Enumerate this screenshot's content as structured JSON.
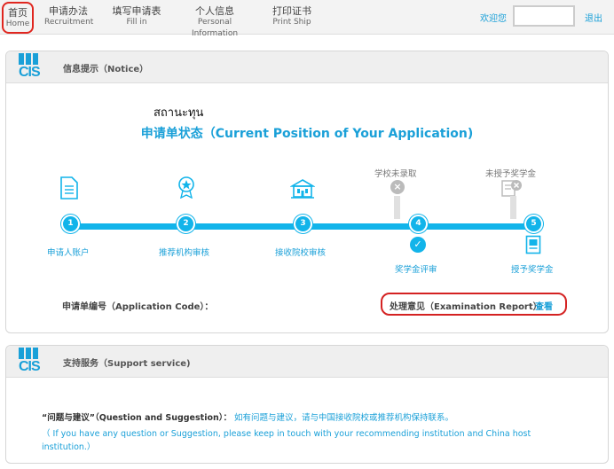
{
  "nav": {
    "home": {
      "cn": "首页",
      "en": "Home"
    },
    "recruitment": {
      "cn": "申请办法",
      "en": "Recruitment"
    },
    "fillin": {
      "cn": "填写申请表",
      "en": "Fill in"
    },
    "personal": {
      "cn": "个人信息",
      "en": "Personal Information"
    },
    "print": {
      "cn": "打印证书",
      "en": "Print Ship"
    },
    "welcome": "欢迎您",
    "logout": "退出"
  },
  "notice_panel": {
    "logo_text": "CIS",
    "title": "信息提示（Notice）",
    "overlay_text": "สถานะทุน",
    "status_title": "申请单状态（Current Position of Your Application)",
    "steps": [
      {
        "num": "1",
        "label": "申请人账户"
      },
      {
        "num": "2",
        "label": "推荐机构审核"
      },
      {
        "num": "3",
        "label": "接收院校审核"
      },
      {
        "num": "4",
        "label": "奖学金评审",
        "above": "学校未录取"
      },
      {
        "num": "5",
        "label": "授予奖学金",
        "above": "未授予奖学金"
      }
    ],
    "app_code_label": "申请单编号（Application Code）：",
    "exam_label": "处理意见（Examination Report）：",
    "exam_link": "查看"
  },
  "support_panel": {
    "logo_text": "CIS",
    "title": "支持服务（Support service)",
    "qa_label": "“问题与建议”（Question and Suggestion）：",
    "qa_cn": "如有问题与建议，请与中国接收院校或推荐机构保持联系。",
    "qa_en": "（ If you have any question or Suggestion, please keep in touch with your recommending institution and China host institution.）"
  },
  "colors": {
    "accent": "#12b4ea",
    "highlight": "#d42222"
  }
}
